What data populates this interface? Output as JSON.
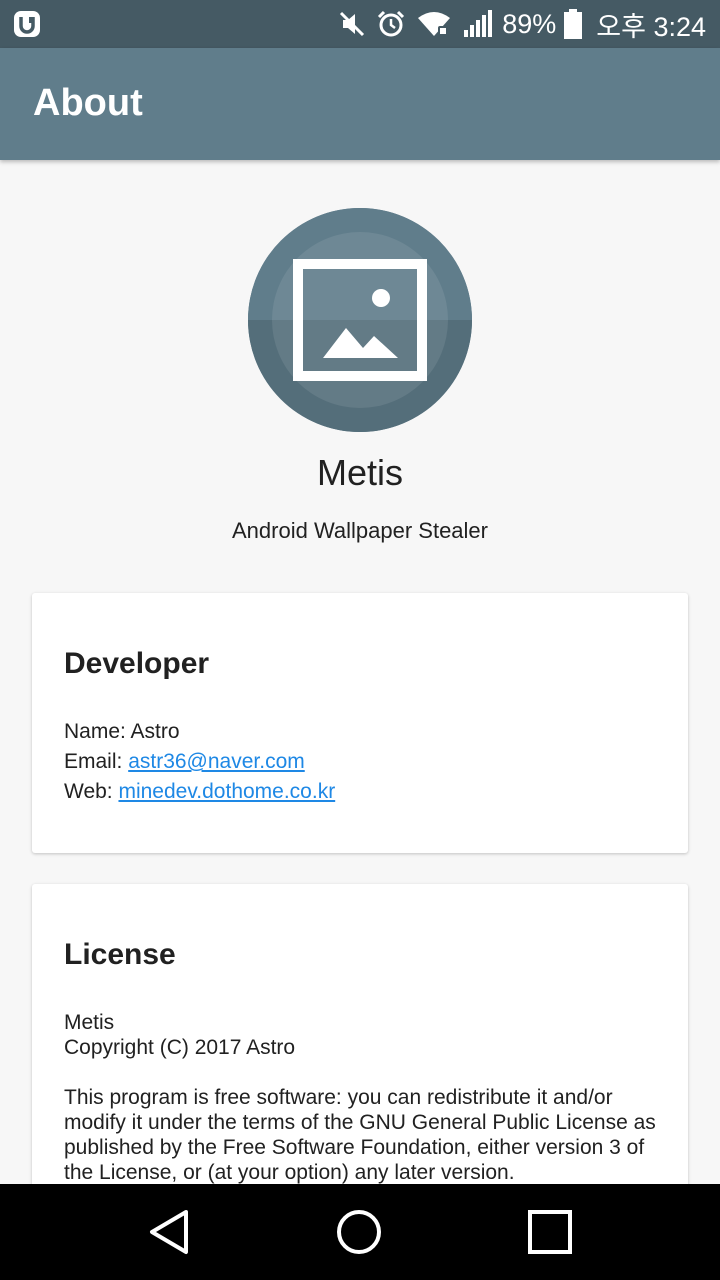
{
  "status_bar": {
    "battery_percent": "89%",
    "time": "오후 3:24",
    "icons": [
      "app-notification-icon",
      "mute-icon",
      "alarm-icon",
      "wifi-icon",
      "signal-icon",
      "battery-icon"
    ]
  },
  "app_bar": {
    "title": "About"
  },
  "app": {
    "name": "Metis",
    "description": "Android Wallpaper Stealer"
  },
  "developer": {
    "title": "Developer",
    "name_label": "Name: ",
    "name_value": "Astro",
    "email_label": "Email: ",
    "email_value": "astr36@naver.com",
    "web_label": "Web: ",
    "web_value": "minedev.dothome.co.kr"
  },
  "license": {
    "title": "License",
    "line1": "Metis",
    "line2": "Copyright (C) 2017 Astro",
    "body": "This program is free software: you can redistribute it and/or modify it under the terms of the GNU General Public License as published by the Free Software Foundation, either version 3 of the License, or (at your option) any later version."
  },
  "nav_bar": {
    "buttons": [
      "back-icon",
      "home-icon",
      "recents-icon"
    ]
  },
  "colors": {
    "status_bar": "#455a64",
    "app_bar": "#607d8b",
    "link": "#1e88e5",
    "background": "#f7f7f7"
  }
}
